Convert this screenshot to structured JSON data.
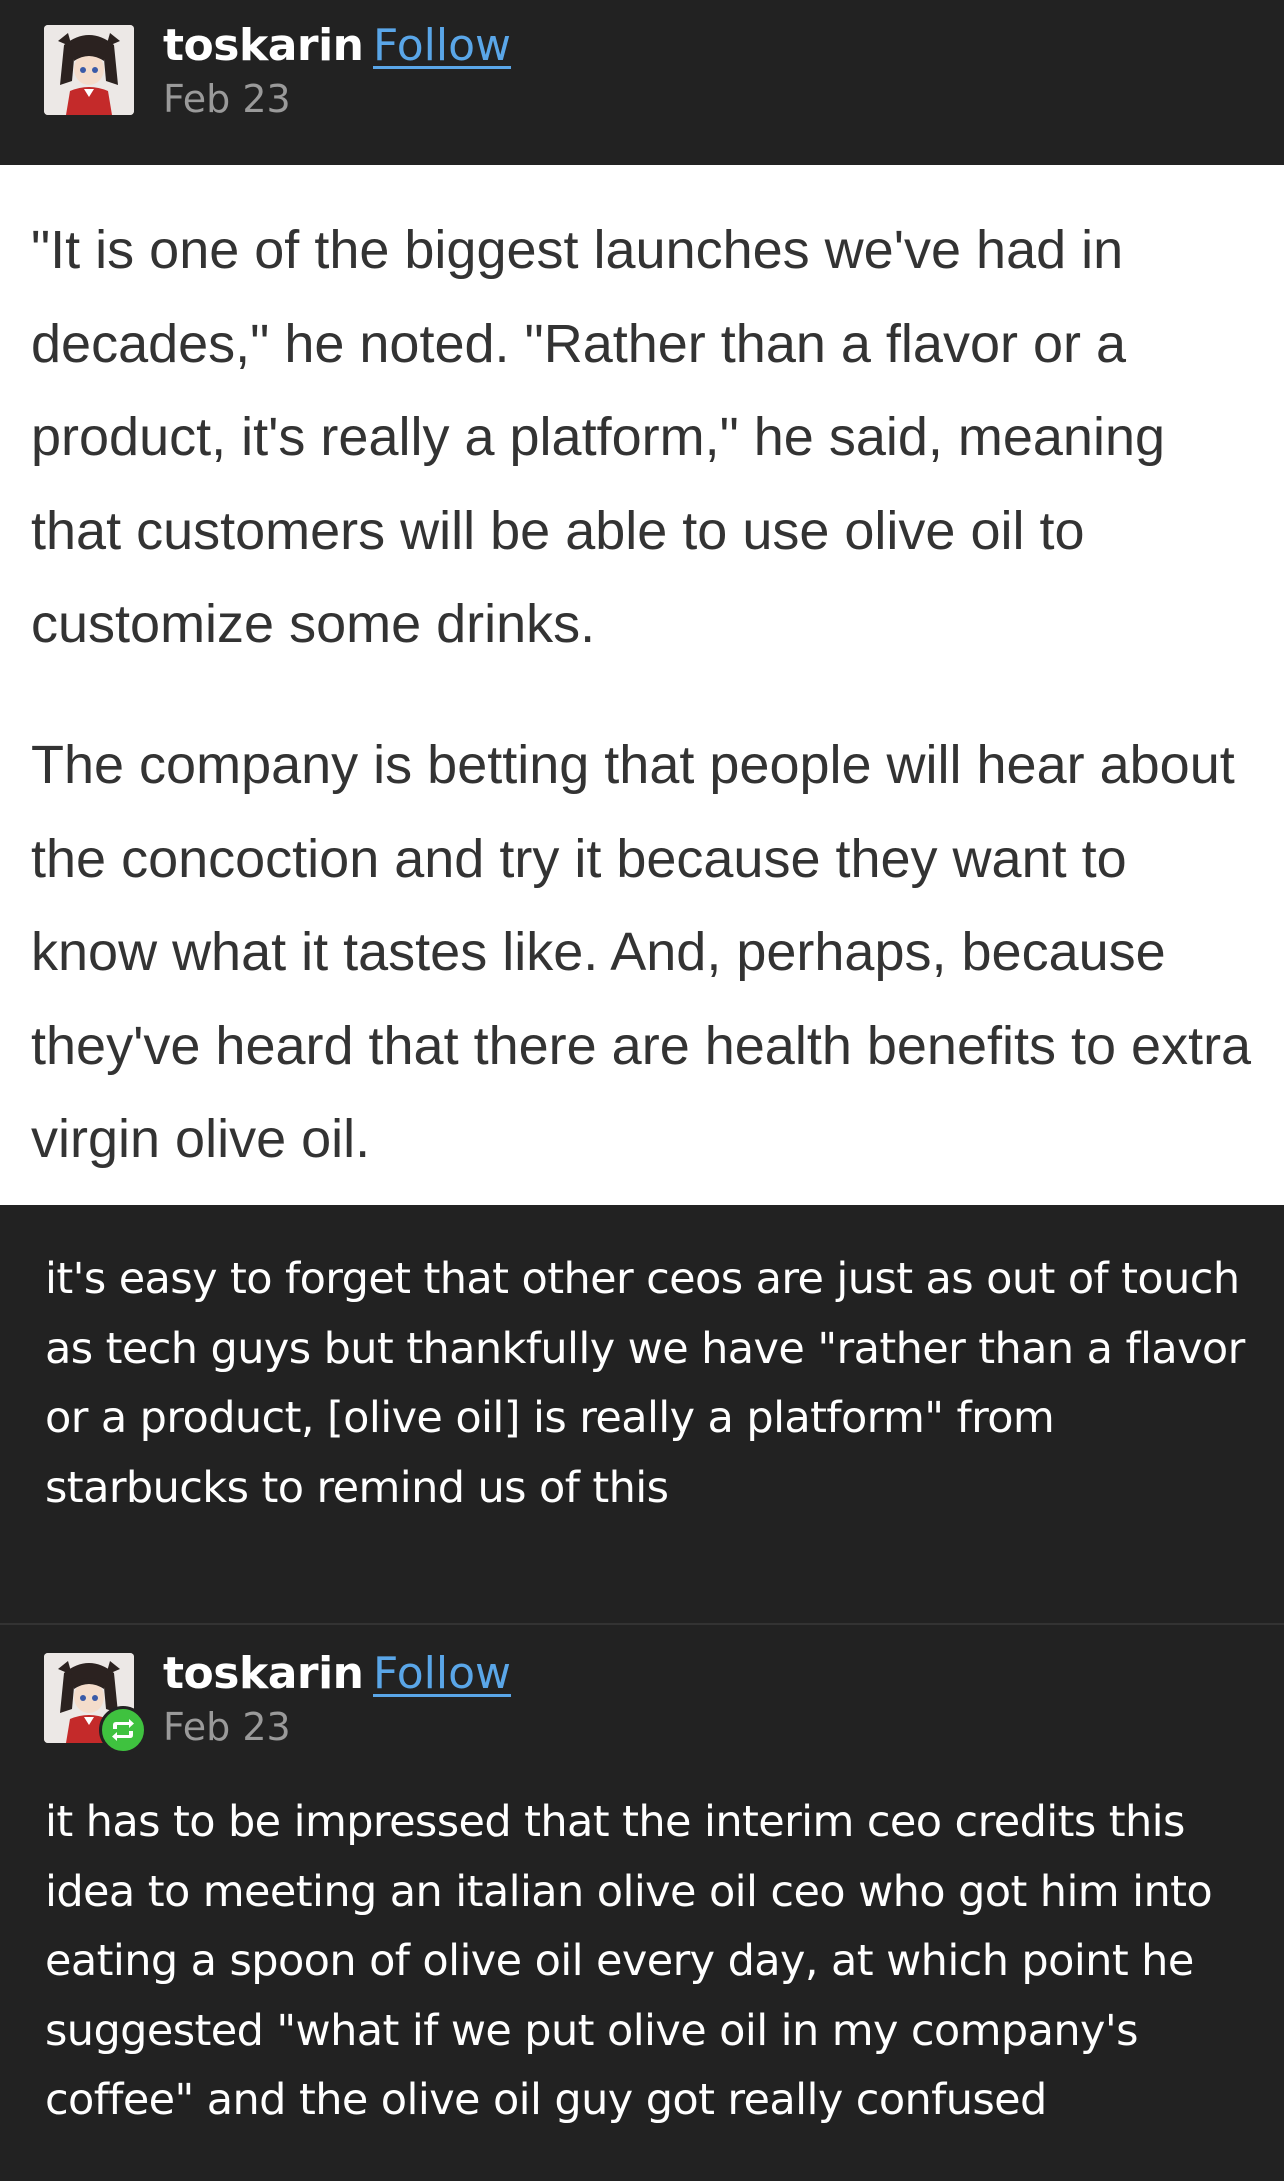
{
  "post1": {
    "username": "toskarin",
    "follow_label": "Follow",
    "date": "Feb 23",
    "avatar_icon": "avatar-anime-girl",
    "quote_paragraphs": [
      "\"It is one of the biggest launches we've had in decades,\" he noted. \"Rather than a flavor or a product, it's really a platform,\" he said, meaning that customers will be able to use olive oil to customize some drinks.",
      "The company is betting that people will hear about the concoction and try it because they want to know what it tastes like. And, perhaps, because they've heard that there are health benefits to extra virgin olive oil."
    ],
    "body": "it's easy to forget that other ceos are just as out of touch as tech guys but thankfully we have \"rather than a flavor or a product, [olive oil] is really a platform\" from starbucks to remind us of this"
  },
  "post2": {
    "username": "toskarin",
    "follow_label": "Follow",
    "date": "Feb 23",
    "avatar_icon": "avatar-anime-girl",
    "badge_icon": "reblog-icon",
    "body": "it has to be impressed that the interim ceo credits this idea to meeting an italian olive oil ceo who got him into eating a spoon of olive oil every day, at which point he suggested \"what if we put olive oil in my company's coffee\" and the olive oil guy got really confused"
  },
  "colors": {
    "background": "#222222",
    "link": "#5aa6e8",
    "date": "#9a9a9a",
    "quote_bg": "#ffffff",
    "quote_text": "#333333",
    "reblog_badge": "#3fc23f"
  }
}
